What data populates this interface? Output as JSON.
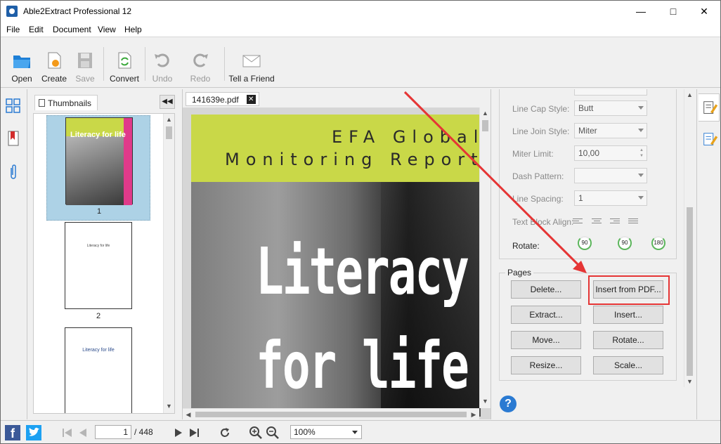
{
  "window": {
    "title": "Able2Extract Professional 12"
  },
  "menu": [
    "File",
    "Edit",
    "Document",
    "View",
    "Help"
  ],
  "toolbar": {
    "open": "Open",
    "create": "Create",
    "save": "Save",
    "convert": "Convert",
    "undo": "Undo",
    "redo": "Redo",
    "tell_friend": "Tell a Friend"
  },
  "thumbnails": {
    "tab_label": "Thumbnails",
    "items": [
      {
        "num": "1",
        "title": "Literacy for life",
        "selected": true
      },
      {
        "num": "2",
        "title": "Literacy for life",
        "selected": false
      },
      {
        "num": "3",
        "title": "Literacy for life",
        "selected": false
      }
    ]
  },
  "document": {
    "tab_name": "141639e.pdf",
    "band_line1": "EFA Global",
    "band_line2": "Monitoring Report",
    "title_line1": "Literacy",
    "title_line2": "for life"
  },
  "properties": {
    "line_cap_style": {
      "label": "Line Cap Style:",
      "value": "Butt"
    },
    "line_join_style": {
      "label": "Line Join Style:",
      "value": "Miter"
    },
    "miter_limit": {
      "label": "Miter Limit:",
      "value": "10,00"
    },
    "dash_pattern": {
      "label": "Dash Pattern:",
      "value": ""
    },
    "line_spacing": {
      "label": "Line Spacing:",
      "value": "1"
    },
    "text_block_align": {
      "label": "Text Block Align:"
    },
    "rotate": {
      "label": "Rotate:",
      "buttons": [
        "90",
        "90",
        "180"
      ]
    }
  },
  "pages_group": {
    "title": "Pages",
    "buttons": {
      "delete": "Delete...",
      "insert_from_pdf": "Insert from PDF...",
      "extract": "Extract...",
      "insert": "Insert...",
      "move": "Move...",
      "rotate": "Rotate...",
      "resize": "Resize...",
      "scale": "Scale..."
    }
  },
  "help": {
    "label": "?"
  },
  "statusbar": {
    "current_page": "1",
    "total_pages": "/ 448",
    "zoom": "100%",
    "facebook": "f"
  },
  "colors": {
    "accent": "#2a7ad2",
    "cover_band": "#c9d848",
    "highlight": "#e53535"
  }
}
